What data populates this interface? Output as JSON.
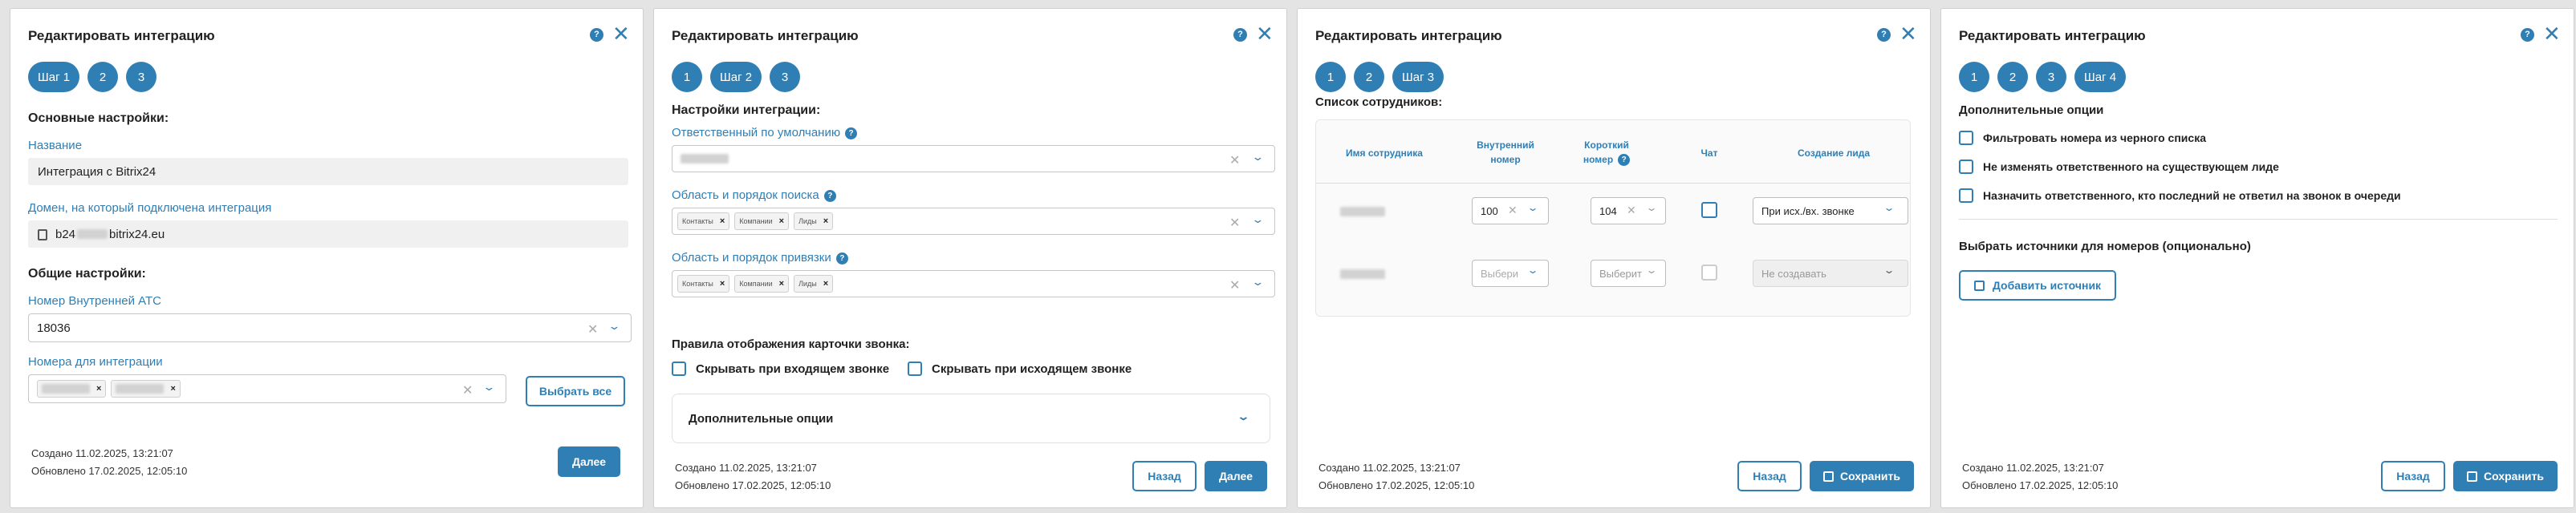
{
  "dialog_title": "Редактировать интеграцию",
  "help_glyph": "?",
  "close_glyph": "✕",
  "clear_glyph": "✕",
  "chevron_glyph": "⌄",
  "chip_remove_glyph": "×",
  "created": "Создано 11.02.2025, 13:21:07",
  "updated": "Обновлено 17.02.2025, 12:05:10",
  "buttons": {
    "next": "Далее",
    "back": "Назад",
    "save": "Сохранить",
    "select_all": "Выбрать все",
    "add_source": "Добавить источник"
  },
  "step1": {
    "steps": [
      "Шаг 1",
      "2",
      "3"
    ],
    "basic_settings": "Основные настройки:",
    "name_label": "Название",
    "name_value": "Интеграция с Bitrix24",
    "domain_label": "Домен, на который подключена интеграция",
    "domain_prefix": "b24",
    "domain_suffix": "bitrix24.eu",
    "common_settings": "Общие настройки:",
    "ats_label": "Номер Внутренней АТС",
    "ats_value": "18036",
    "numbers_label": "Номера для интеграции"
  },
  "step2": {
    "steps": [
      "1",
      "Шаг 2",
      "3"
    ],
    "settings": "Настройки интеграции:",
    "responsible_label": "Ответственный по умолчанию",
    "search_label": "Область и порядок поиска",
    "binding_label": "Область и порядок привязки",
    "chips": [
      "Контакты",
      "Компании",
      "Лиды"
    ],
    "rules_title": "Правила отображения карточки звонка:",
    "hide_incoming": "Скрывать при входящем звонке",
    "hide_outgoing": "Скрывать при исходящем звонке",
    "extra_options": "Дополнительные опции"
  },
  "step3": {
    "steps": [
      "1",
      "2",
      "Шаг 3"
    ],
    "list_title": "Список сотрудников:",
    "columns": [
      "Имя сотрудника",
      "Внутренний номер",
      "Короткий номер",
      "Чат",
      "Создание лида"
    ],
    "row1": {
      "internal": "100",
      "short": "104",
      "lead": "При исх./вх. звонке"
    },
    "row2": {
      "internal": "Выбери",
      "short": "Выберит",
      "lead": "Не создавать"
    }
  },
  "step4": {
    "steps": [
      "1",
      "2",
      "3",
      "Шаг 4"
    ],
    "extra_options": "Дополнительные опции",
    "options": [
      "Фильтровать номера из черного списка",
      "Не изменять ответственного на существующем лиде",
      "Назначить ответственного, кто последний не ответил на звонок в очереди"
    ],
    "sources_title": "Выбрать источники для номеров (опционально)"
  }
}
